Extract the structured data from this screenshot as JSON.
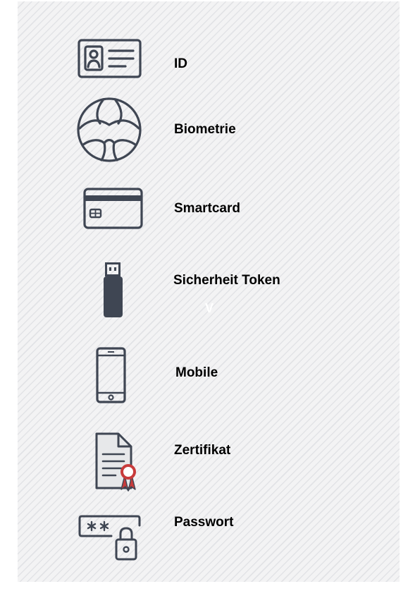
{
  "items": [
    {
      "label": "ID",
      "icon": "id-card-icon"
    },
    {
      "label": "Biometrie",
      "icon": "biometric-face-icon"
    },
    {
      "label": "Smartcard",
      "icon": "smartcard-icon"
    },
    {
      "label": "Sicherheit Token",
      "icon": "usb-token-icon"
    },
    {
      "label": "Mobile",
      "icon": "mobile-phone-icon"
    },
    {
      "label": "Zertifikat",
      "icon": "certificate-icon"
    },
    {
      "label": "Passwort",
      "icon": "password-lock-icon"
    }
  ],
  "stray_mark": "V",
  "colors": {
    "icon": "#3f4653",
    "award": "#c83b3b",
    "stripe": "#e2e3e6",
    "background": "#f3f3f4"
  }
}
